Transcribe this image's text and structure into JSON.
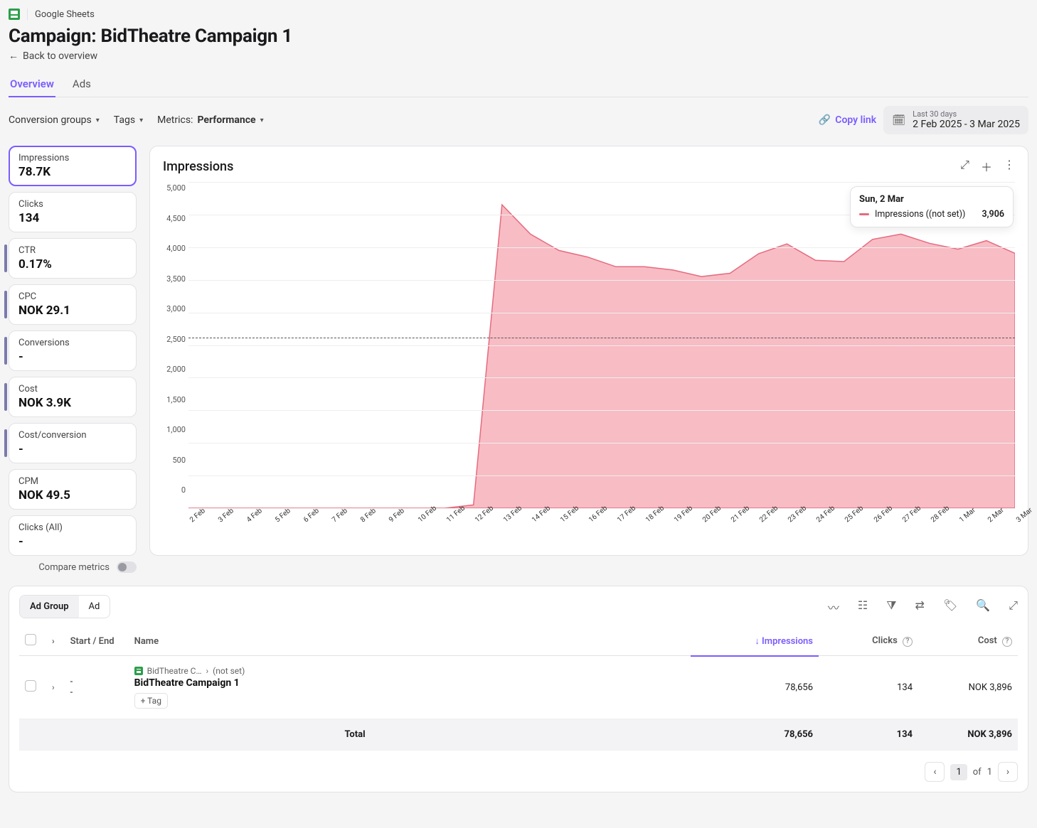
{
  "source": {
    "icon_label": "Google Sheets"
  },
  "page": {
    "title": "Campaign: BidTheatre Campaign 1",
    "back_label": "Back to overview"
  },
  "tabs": {
    "overview": "Overview",
    "ads": "Ads"
  },
  "toolbar": {
    "conversion_groups": "Conversion groups",
    "tags": "Tags",
    "metrics_label": "Metrics:",
    "metrics_value": "Performance",
    "copy_link": "Copy link",
    "date_small": "Last 30 days",
    "date_range": "2 Feb 2025 - 3 Mar 2025"
  },
  "metrics": {
    "list": [
      {
        "label": "Impressions",
        "value": "78.7K",
        "active": true,
        "bar": false
      },
      {
        "label": "Clicks",
        "value": "134",
        "active": false,
        "bar": false
      },
      {
        "label": "CTR",
        "value": "0.17%",
        "active": false,
        "bar": true
      },
      {
        "label": "CPC",
        "value": "NOK 29.1",
        "active": false,
        "bar": true
      },
      {
        "label": "Conversions",
        "value": "-",
        "active": false,
        "bar": true
      },
      {
        "label": "Cost",
        "value": "NOK 3.9K",
        "active": false,
        "bar": true
      },
      {
        "label": "Cost/conversion",
        "value": "-",
        "active": false,
        "bar": true
      },
      {
        "label": "CPM",
        "value": "NOK 49.5",
        "active": false,
        "bar": false
      },
      {
        "label": "Clicks (All)",
        "value": "-",
        "active": false,
        "bar": false
      }
    ],
    "compare_label": "Compare metrics"
  },
  "chart": {
    "title": "Impressions",
    "legend": {
      "date": "Sun, 2 Mar",
      "series": "Impressions ((not set))",
      "value": "3,906"
    }
  },
  "table": {
    "seg_adgroup": "Ad Group",
    "seg_ad": "Ad",
    "cols": {
      "start_end": "Start / End",
      "name": "Name",
      "impr": "Impressions",
      "clicks": "Clicks",
      "cost": "Cost",
      "sort_arrow": "↓"
    },
    "row": {
      "start": "-",
      "end": "-",
      "bc1": "BidTheatre C…",
      "bc2": "(not set)",
      "name": "BidTheatre Campaign 1",
      "tag_btn": "+ Tag",
      "impr": "78,656",
      "clicks": "134",
      "cost": "NOK 3,896"
    },
    "total": {
      "label": "Total",
      "impr": "78,656",
      "clicks": "134",
      "cost": "NOK 3,896"
    },
    "pager": {
      "page": "1",
      "of_label": "of",
      "total": "1"
    }
  },
  "chart_data": {
    "type": "area",
    "title": "Impressions",
    "xlabel": "",
    "ylabel": "",
    "ylim": [
      0,
      5000
    ],
    "y_ticks": [
      0,
      500,
      1000,
      1500,
      2000,
      2500,
      3000,
      3500,
      4000,
      4500,
      5000
    ],
    "reference_line": 2620,
    "categories": [
      "2 Feb",
      "3 Feb",
      "4 Feb",
      "5 Feb",
      "6 Feb",
      "7 Feb",
      "8 Feb",
      "9 Feb",
      "10 Feb",
      "11 Feb",
      "12 Feb",
      "13 Feb",
      "14 Feb",
      "15 Feb",
      "16 Feb",
      "17 Feb",
      "18 Feb",
      "19 Feb",
      "20 Feb",
      "21 Feb",
      "22 Feb",
      "23 Feb",
      "24 Feb",
      "25 Feb",
      "26 Feb",
      "27 Feb",
      "28 Feb",
      "1 Mar",
      "2 Mar",
      "3 Mar"
    ],
    "series": [
      {
        "name": "Impressions ((not set))",
        "values": [
          0,
          0,
          0,
          0,
          0,
          0,
          0,
          0,
          0,
          0,
          50,
          4650,
          4200,
          3950,
          3850,
          3700,
          3700,
          3650,
          3550,
          3600,
          3900,
          4050,
          3800,
          3780,
          4120,
          4200,
          4060,
          3970,
          4100,
          3906
        ]
      }
    ]
  }
}
